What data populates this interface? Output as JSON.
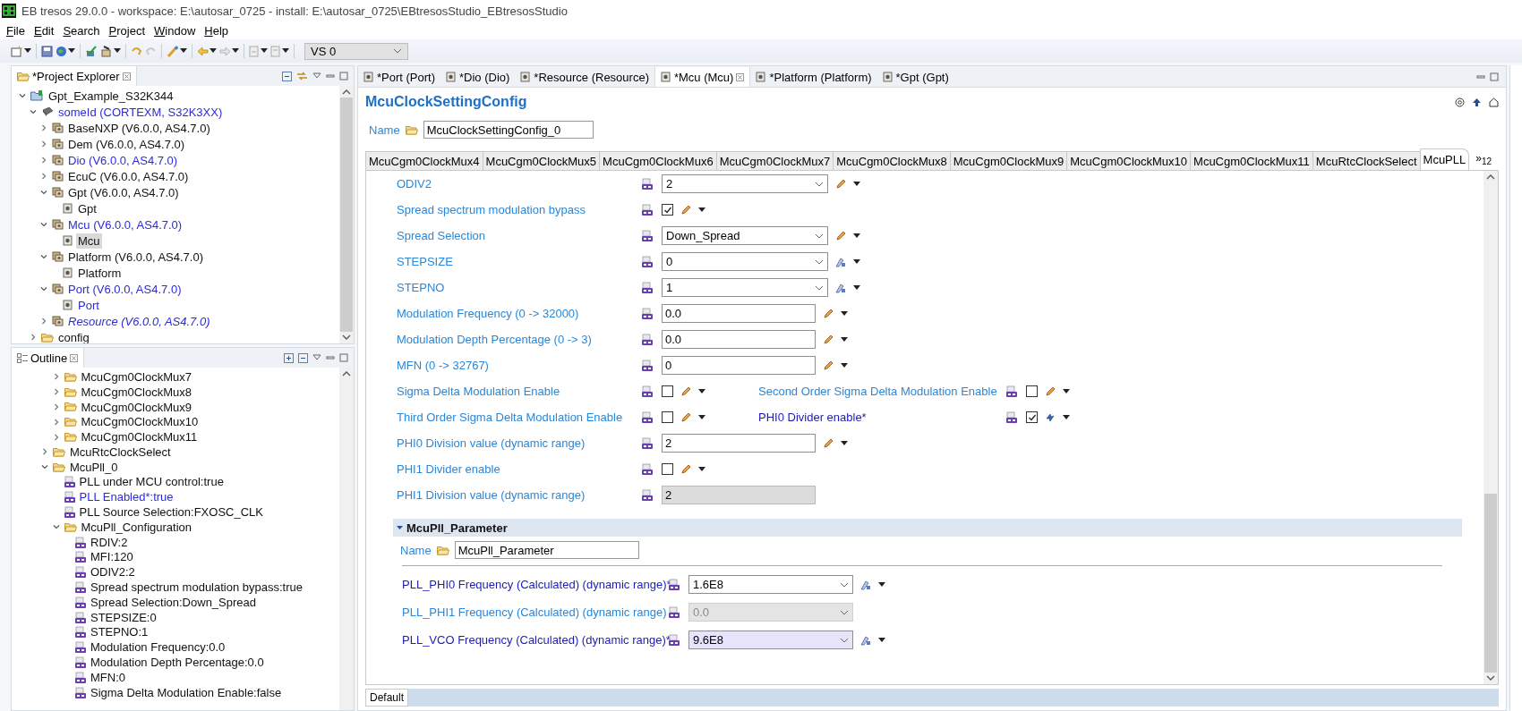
{
  "window": {
    "title": "EB tresos 29.0.0 - workspace: E:\\autosar_0725 - install: E:\\autosar_0725\\EBtresosStudio_EBtresosStudio"
  },
  "menu": [
    "File",
    "Edit",
    "Search",
    "Project",
    "Window",
    "Help"
  ],
  "toolbar": {
    "variant_select": {
      "value": "VS 0"
    }
  },
  "project_explorer": {
    "title": "*Project Explorer",
    "items": [
      {
        "label": "Gpt_Example_S32K344",
        "kind": "project",
        "expanded": true,
        "selected": false,
        "modified": false,
        "italic": false,
        "children": [
          {
            "label": "someId (CORTEXM, S32K3XX)",
            "kind": "ecu",
            "expanded": true,
            "selected": false,
            "modified": true,
            "italic": false,
            "children": [
              {
                "label": "BaseNXP (V6.0.0, AS4.7.0)",
                "kind": "module",
                "expanded": false,
                "selected": false,
                "modified": false,
                "italic": false
              },
              {
                "label": "Dem (V6.0.0, AS4.7.0)",
                "kind": "module",
                "expanded": false,
                "selected": false,
                "modified": false,
                "italic": false
              },
              {
                "label": "Dio (V6.0.0, AS4.7.0)",
                "kind": "module",
                "expanded": false,
                "selected": false,
                "modified": true,
                "italic": false
              },
              {
                "label": "EcuC (V6.0.0, AS4.7.0)",
                "kind": "module",
                "expanded": false,
                "selected": false,
                "modified": false,
                "italic": false
              },
              {
                "label": "Gpt (V6.0.0, AS4.7.0)",
                "kind": "module",
                "expanded": true,
                "selected": false,
                "modified": false,
                "italic": false,
                "children": [
                  {
                    "label": "Gpt",
                    "kind": "config",
                    "selected": false,
                    "modified": false,
                    "italic": false
                  }
                ]
              },
              {
                "label": "Mcu (V6.0.0, AS4.7.0)",
                "kind": "module",
                "expanded": true,
                "selected": false,
                "modified": true,
                "italic": false,
                "children": [
                  {
                    "label": "Mcu",
                    "kind": "config",
                    "selected": true,
                    "modified": false,
                    "italic": false
                  }
                ]
              },
              {
                "label": "Platform (V6.0.0, AS4.7.0)",
                "kind": "module",
                "expanded": true,
                "selected": false,
                "modified": false,
                "italic": false,
                "children": [
                  {
                    "label": "Platform",
                    "kind": "config",
                    "selected": false,
                    "modified": false,
                    "italic": false
                  }
                ]
              },
              {
                "label": "Port (V6.0.0, AS4.7.0)",
                "kind": "module",
                "expanded": true,
                "selected": false,
                "modified": true,
                "italic": false,
                "children": [
                  {
                    "label": "Port",
                    "kind": "config",
                    "selected": false,
                    "modified": true,
                    "italic": false
                  }
                ]
              },
              {
                "label": "Resource (V6.0.0, AS4.7.0)",
                "kind": "module",
                "expanded": false,
                "selected": false,
                "modified": true,
                "italic": true
              }
            ]
          },
          {
            "label": "config",
            "kind": "folder",
            "expanded": false,
            "selected": false,
            "modified": false,
            "italic": false
          }
        ]
      }
    ]
  },
  "outline": {
    "title": "Outline",
    "items": [
      {
        "children": [
          {
            "label": "McuCgm0ClockMux7",
            "kind": "folder",
            "expanded": false,
            "selected": false,
            "modified": false
          },
          {
            "label": "McuCgm0ClockMux8",
            "kind": "folder",
            "expanded": false,
            "selected": false,
            "modified": false
          },
          {
            "label": "McuCgm0ClockMux9",
            "kind": "folder",
            "expanded": false,
            "selected": false,
            "modified": false
          },
          {
            "label": "McuCgm0ClockMux10",
            "kind": "folder",
            "expanded": false,
            "selected": false,
            "modified": false
          },
          {
            "label": "McuCgm0ClockMux11",
            "kind": "folder",
            "expanded": false,
            "selected": false,
            "modified": false
          }
        ]
      },
      {
        "label": "McuRtcClockSelect",
        "kind": "folder",
        "expanded": false,
        "selected": false,
        "modified": false
      },
      {
        "label": "McuPll_0",
        "kind": "folder",
        "expanded": true,
        "selected": false,
        "modified": false,
        "children": [
          {
            "label": "PLL under MCU control:true",
            "kind": "param",
            "selected": false,
            "modified": false
          },
          {
            "label": "PLL Enabled*:true",
            "kind": "param",
            "selected": false,
            "modified": true
          },
          {
            "label": "PLL Source Selection:FXOSC_CLK",
            "kind": "param",
            "selected": false,
            "modified": false
          },
          {
            "label": "McuPll_Configuration",
            "kind": "folder",
            "expanded": true,
            "selected": false,
            "modified": false,
            "children": [
              {
                "label": "RDIV:2",
                "kind": "param",
                "selected": false,
                "modified": false
              },
              {
                "label": "MFI:120",
                "kind": "param",
                "selected": false,
                "modified": false
              },
              {
                "label": "ODIV2:2",
                "kind": "param",
                "selected": false,
                "modified": false
              },
              {
                "label": "Spread spectrum modulation bypass:true",
                "kind": "param",
                "selected": false,
                "modified": false
              },
              {
                "label": "Spread Selection:Down_Spread",
                "kind": "param",
                "selected": false,
                "modified": false
              },
              {
                "label": "STEPSIZE:0",
                "kind": "param",
                "selected": false,
                "modified": false
              },
              {
                "label": "STEPNO:1",
                "kind": "param",
                "selected": false,
                "modified": false
              },
              {
                "label": "Modulation Frequency:0.0",
                "kind": "param",
                "selected": false,
                "modified": false
              },
              {
                "label": "Modulation Depth Percentage:0.0",
                "kind": "param",
                "selected": false,
                "modified": false
              },
              {
                "label": "MFN:0",
                "kind": "param",
                "selected": false,
                "modified": false
              },
              {
                "label": "Sigma Delta Modulation Enable:false",
                "kind": "param",
                "selected": false,
                "modified": false
              }
            ]
          }
        ]
      }
    ]
  },
  "editor": {
    "tabs": [
      {
        "label": "*Port (Port)",
        "selected": false
      },
      {
        "label": "*Dio (Dio)",
        "selected": false
      },
      {
        "label": "*Resource (Resource)",
        "selected": false
      },
      {
        "label": "*Mcu (Mcu)",
        "selected": true
      },
      {
        "label": "*Platform (Platform)",
        "selected": false
      },
      {
        "label": "*Gpt (Gpt)",
        "selected": false
      }
    ],
    "header": "McuClockSettingConfig",
    "name": {
      "label": "Name",
      "value": "McuClockSettingConfig_0"
    },
    "subtabs": [
      {
        "label": "McuCgm0ClockMux4",
        "selected": false
      },
      {
        "label": "McuCgm0ClockMux5",
        "selected": false
      },
      {
        "label": "McuCgm0ClockMux6",
        "selected": false
      },
      {
        "label": "McuCgm0ClockMux7",
        "selected": false
      },
      {
        "label": "McuCgm0ClockMux8",
        "selected": false
      },
      {
        "label": "McuCgm0ClockMux9",
        "selected": false
      },
      {
        "label": "McuCgm0ClockMux10",
        "selected": false
      },
      {
        "label": "McuCgm0ClockMux11",
        "selected": false
      },
      {
        "label": "McuRtcClockSelect",
        "selected": false
      },
      {
        "label": "McuPLL",
        "selected": true
      }
    ],
    "subtab_overflow": {
      "symbol": "»",
      "count": "12"
    },
    "rows": [
      {
        "kind": "combo",
        "label": "ODIV2",
        "value": "2",
        "calculated": false,
        "modified": false,
        "disabled": false
      },
      {
        "kind": "check",
        "label": "Spread spectrum modulation bypass",
        "checked": true,
        "calculated": false,
        "modified": false
      },
      {
        "kind": "combo",
        "label": "Spread Selection",
        "value": "Down_Spread",
        "calculated": false,
        "modified": false,
        "disabled": false
      },
      {
        "kind": "combo",
        "label": "STEPSIZE",
        "value": "0",
        "calculated": true,
        "modified": false,
        "disabled": false
      },
      {
        "kind": "combo",
        "label": "STEPNO",
        "value": "1",
        "calculated": true,
        "modified": false,
        "disabled": false
      },
      {
        "kind": "text",
        "label": "Modulation Frequency (0 -> 32000)",
        "value": "0.0",
        "calculated": false,
        "modified": false,
        "disabled": false
      },
      {
        "kind": "text",
        "label": "Modulation Depth Percentage (0 -> 3)",
        "value": "0.0",
        "calculated": false,
        "modified": false,
        "disabled": false
      },
      {
        "kind": "text",
        "label": "MFN (0 -> 32767)",
        "value": "0",
        "calculated": false,
        "modified": false,
        "disabled": false
      },
      {
        "kind": "check",
        "label": "Sigma Delta Modulation Enable",
        "checked": false,
        "calculated": false,
        "modified": false,
        "pair": {
          "label": "Second Order Sigma Delta Modulation Enable",
          "checked": false,
          "linked": false,
          "modified": false
        }
      },
      {
        "kind": "check",
        "label": "Third Order Sigma Delta Modulation Enable",
        "checked": false,
        "calculated": false,
        "modified": false,
        "pair": {
          "label": "PHI0 Divider enable*",
          "checked": true,
          "linked": true,
          "modified": true
        }
      },
      {
        "kind": "text",
        "label": "PHI0 Division value (dynamic range)",
        "value": "2",
        "calculated": false,
        "modified": false,
        "disabled": false
      },
      {
        "kind": "check",
        "label": "PHI1 Divider enable",
        "checked": false,
        "calculated": false,
        "modified": false
      },
      {
        "kind": "text",
        "label": "PHI1 Division value (dynamic range)",
        "value": "2",
        "modified": false,
        "disabled": true
      }
    ],
    "section": {
      "title": "McuPll_Parameter",
      "expanded": true,
      "name": {
        "label": "Name",
        "value": "McuPll_Parameter"
      },
      "rows": [
        {
          "kind": "combo",
          "label": "PLL_PHI0 Frequency (Calculated) (dynamic range)*",
          "value": "1.6E8",
          "calculated": true,
          "modified": true,
          "disabled": false,
          "focused": false
        },
        {
          "kind": "combo",
          "label": "PLL_PHI1 Frequency (Calculated) (dynamic range)",
          "value": "0.0",
          "modified": false,
          "disabled": true,
          "focused": false
        },
        {
          "kind": "combo",
          "label": "PLL_VCO Frequency (Calculated) (dynamic range)*",
          "value": "9.6E8",
          "calculated": true,
          "modified": true,
          "disabled": false,
          "focused": true
        }
      ]
    },
    "bottom_tabs": [
      {
        "label": "Default",
        "selected": true
      }
    ]
  }
}
